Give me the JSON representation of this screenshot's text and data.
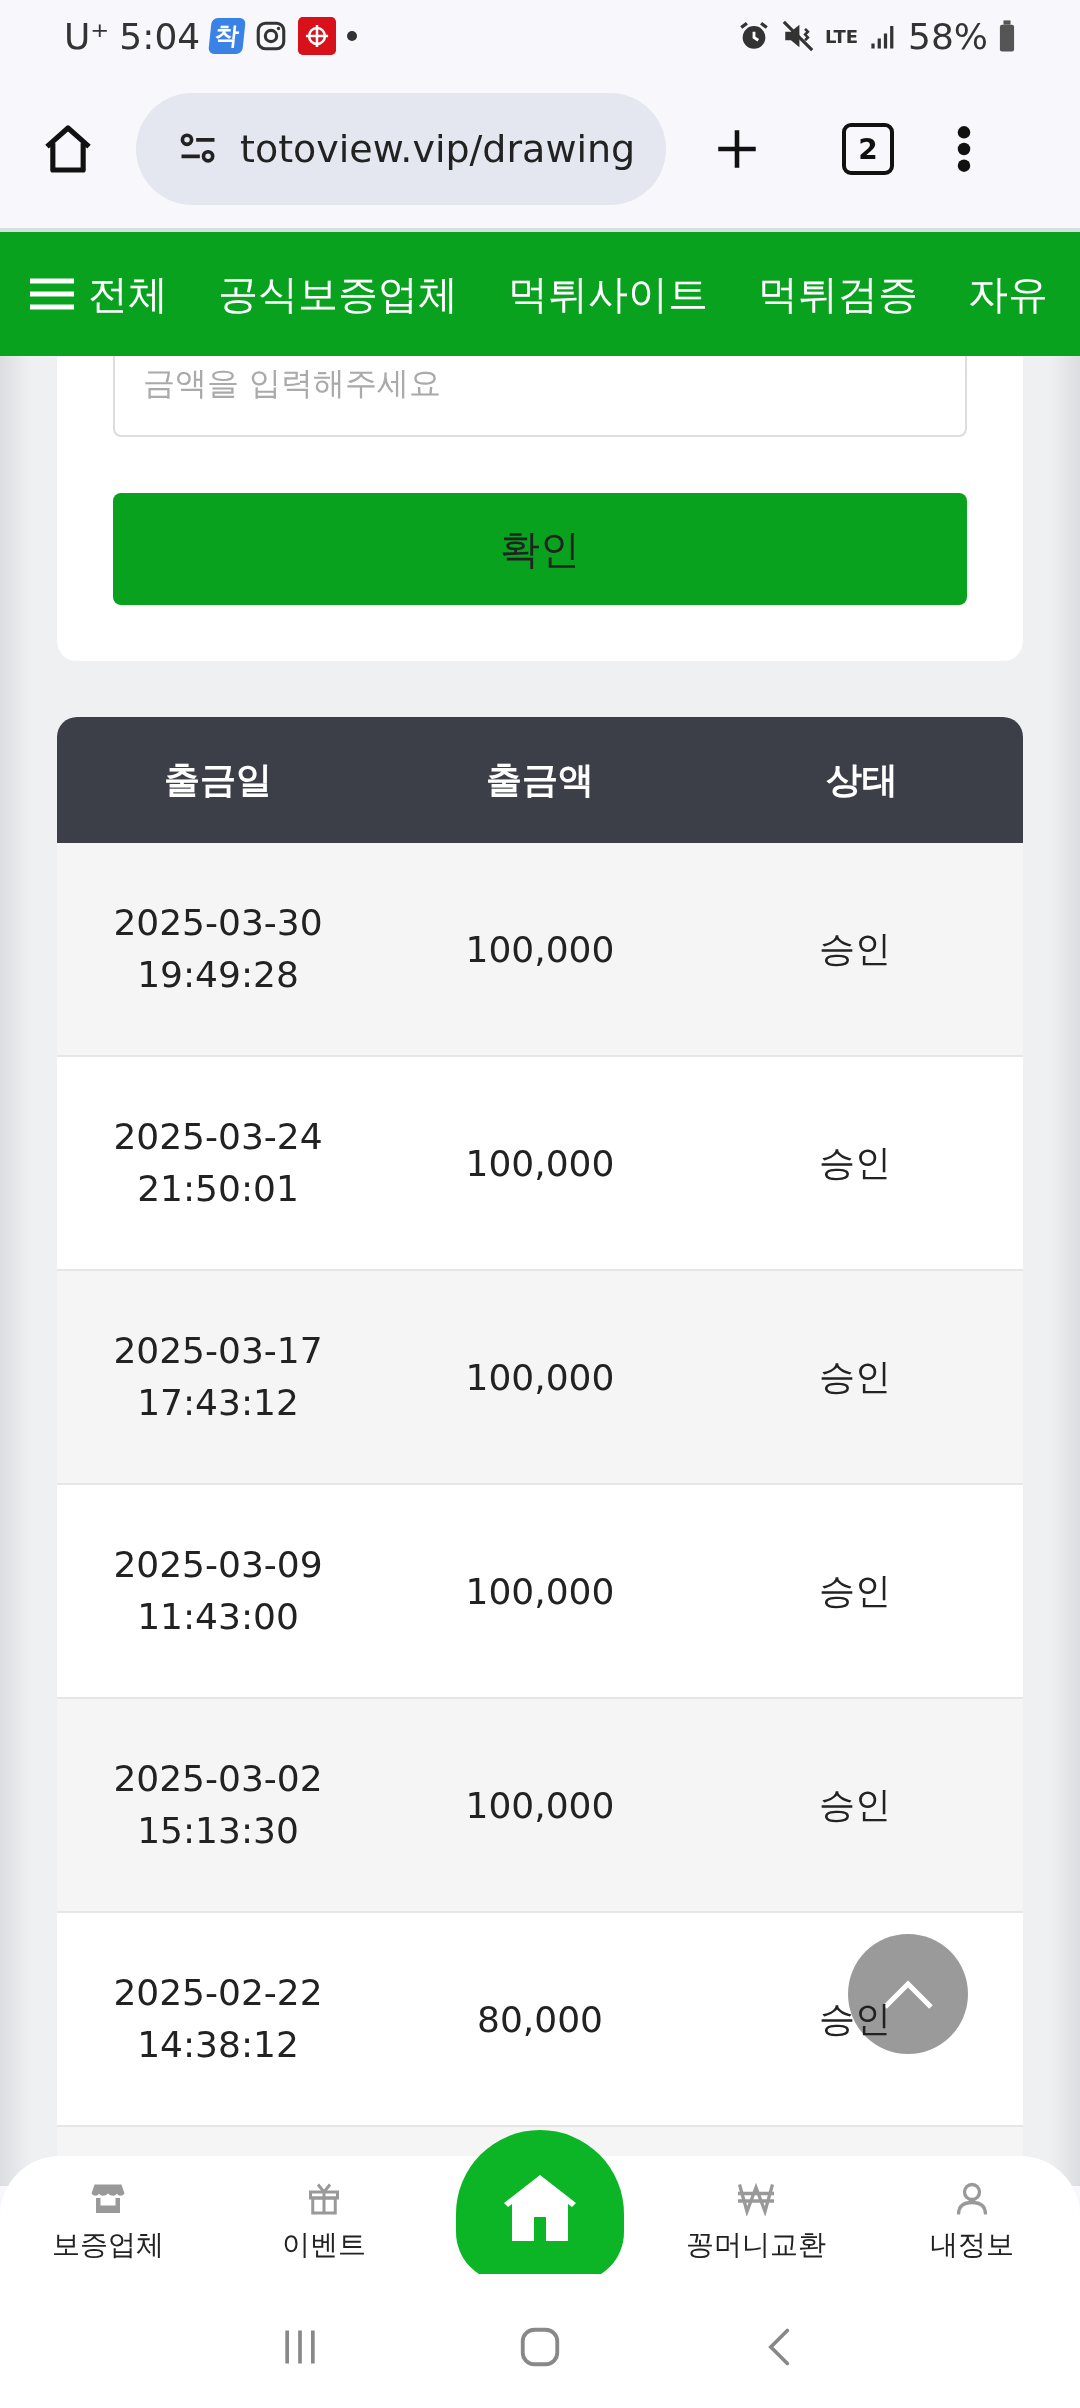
{
  "status_bar": {
    "carrier": "U⁺",
    "time": "5:04",
    "notification_badge": "착",
    "battery": "58%",
    "network": "LTE"
  },
  "browser": {
    "url": "totoview.vip/drawing",
    "tab_count": "2"
  },
  "nav_menu": {
    "all_label": "전체",
    "items": [
      "공식보증업체",
      "먹튀사이트",
      "먹튀검증",
      "자유"
    ]
  },
  "form": {
    "amount_placeholder": "금액을 입력해주세요",
    "confirm_button": "확인"
  },
  "table": {
    "columns": [
      "출금일",
      "출금액",
      "상태"
    ],
    "rows": [
      {
        "date": "2025-03-30",
        "time": "19:49:28",
        "amount": "100,000",
        "status": "승인"
      },
      {
        "date": "2025-03-24",
        "time": "21:50:01",
        "amount": "100,000",
        "status": "승인"
      },
      {
        "date": "2025-03-17",
        "time": "17:43:12",
        "amount": "100,000",
        "status": "승인"
      },
      {
        "date": "2025-03-09",
        "time": "11:43:00",
        "amount": "100,000",
        "status": "승인"
      },
      {
        "date": "2025-03-02",
        "time": "15:13:30",
        "amount": "100,000",
        "status": "승인"
      },
      {
        "date": "2025-02-22",
        "time": "14:38:12",
        "amount": "80,000",
        "status": "승인"
      }
    ]
  },
  "bottom_nav": [
    {
      "kind": "store",
      "label": "보증업체"
    },
    {
      "kind": "gift",
      "label": "이벤트"
    },
    {
      "kind": "home"
    },
    {
      "kind": "won",
      "label": "꽁머니교환"
    },
    {
      "kind": "person",
      "label": "내정보"
    }
  ]
}
